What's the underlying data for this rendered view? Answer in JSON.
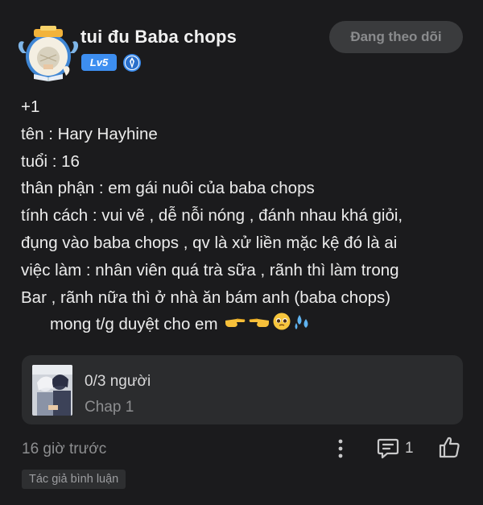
{
  "post": {
    "username": "tui đu Baba chops",
    "level": "Lv5",
    "follow_label": "Đang theo dõi",
    "content_lines": [
      "+1",
      "tên : Hary Hayhine",
      "tuổi : 16",
      "thân phận : em gái nuôi của baba chops",
      "tính cách : vui vẽ , dễ nỗi nóng , đánh nhau khá giỏi,",
      "đụng vào baba chops , qv là xử liền mặc kệ đó là ai",
      "việc làm : nhân viên quá trà sữa , rãnh thì làm trong",
      "Bar , rãnh nữa thì ở nhà ăn bám anh (baba chops)",
      "mong t/g duyệt cho em"
    ],
    "emojis": [
      "pointing-right-icon",
      "pointing-left-icon",
      "pleading-face-icon",
      "sweat-droplets-icon"
    ]
  },
  "story_card": {
    "title": "0/3 người",
    "subtitle": "Chap 1"
  },
  "footer": {
    "timestamp": "16 giờ trước",
    "comment_count": "1",
    "author_tag": "Tác giả bình luận"
  },
  "colors": {
    "background": "#1b1b1d",
    "card": "#2b2c2e",
    "level_badge": "#3d8ef0",
    "follow_button": "#3a3b3d"
  }
}
